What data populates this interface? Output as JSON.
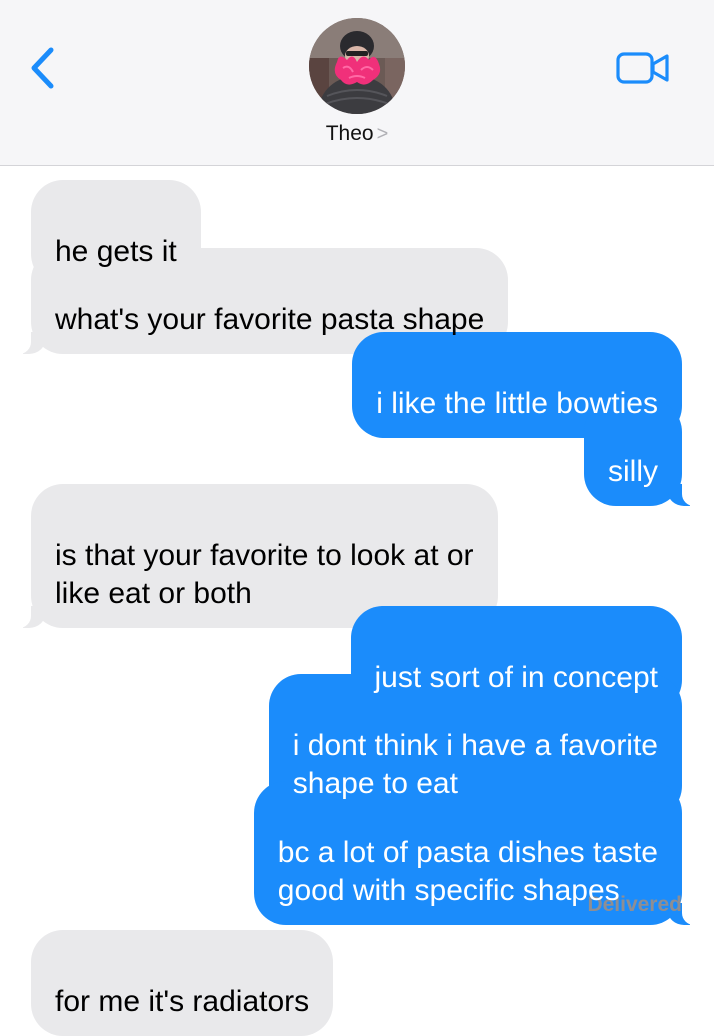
{
  "header": {
    "contact_name": "Theo",
    "chevron": ">",
    "accent_color": "#1b8cfb",
    "back_icon": "chevron-left-icon",
    "video_icon": "video-camera-icon"
  },
  "messages": [
    {
      "from": "them",
      "text": "he gets it"
    },
    {
      "from": "them",
      "text": "what's your favorite pasta shape"
    },
    {
      "from": "me",
      "text": "i like the little bowties"
    },
    {
      "from": "me",
      "text": "silly"
    },
    {
      "from": "them",
      "text": "is that your favorite to look at or\nlike eat or both"
    },
    {
      "from": "me",
      "text": "just sort of in concept"
    },
    {
      "from": "me",
      "text": "i dont think i have a favorite\nshape to eat"
    },
    {
      "from": "me",
      "text": "bc a lot of pasta dishes taste\ngood with specific shapes"
    },
    {
      "from": "them",
      "text": "for me it's radiators"
    }
  ],
  "status": {
    "delivered_label": "Delivered"
  },
  "colors": {
    "sent_bubble": "#1b8cfb",
    "received_bubble": "#e9e9eb",
    "header_bg": "#f6f6f8"
  }
}
